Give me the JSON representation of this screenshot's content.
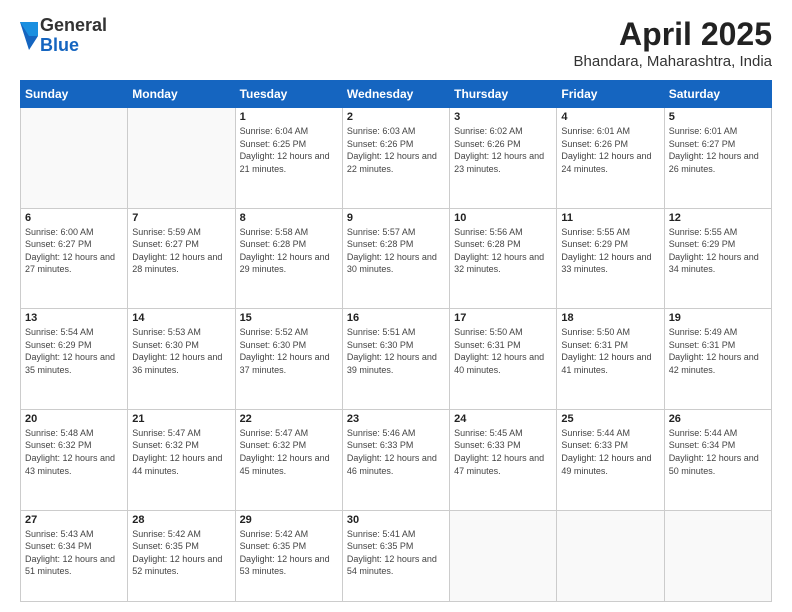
{
  "header": {
    "logo_general": "General",
    "logo_blue": "Blue",
    "title": "April 2025",
    "subtitle": "Bhandara, Maharashtra, India"
  },
  "weekdays": [
    "Sunday",
    "Monday",
    "Tuesday",
    "Wednesday",
    "Thursday",
    "Friday",
    "Saturday"
  ],
  "weeks": [
    [
      {
        "day": "",
        "sunrise": "",
        "sunset": "",
        "daylight": ""
      },
      {
        "day": "",
        "sunrise": "",
        "sunset": "",
        "daylight": ""
      },
      {
        "day": "1",
        "sunrise": "Sunrise: 6:04 AM",
        "sunset": "Sunset: 6:25 PM",
        "daylight": "Daylight: 12 hours and 21 minutes."
      },
      {
        "day": "2",
        "sunrise": "Sunrise: 6:03 AM",
        "sunset": "Sunset: 6:26 PM",
        "daylight": "Daylight: 12 hours and 22 minutes."
      },
      {
        "day": "3",
        "sunrise": "Sunrise: 6:02 AM",
        "sunset": "Sunset: 6:26 PM",
        "daylight": "Daylight: 12 hours and 23 minutes."
      },
      {
        "day": "4",
        "sunrise": "Sunrise: 6:01 AM",
        "sunset": "Sunset: 6:26 PM",
        "daylight": "Daylight: 12 hours and 24 minutes."
      },
      {
        "day": "5",
        "sunrise": "Sunrise: 6:01 AM",
        "sunset": "Sunset: 6:27 PM",
        "daylight": "Daylight: 12 hours and 26 minutes."
      }
    ],
    [
      {
        "day": "6",
        "sunrise": "Sunrise: 6:00 AM",
        "sunset": "Sunset: 6:27 PM",
        "daylight": "Daylight: 12 hours and 27 minutes."
      },
      {
        "day": "7",
        "sunrise": "Sunrise: 5:59 AM",
        "sunset": "Sunset: 6:27 PM",
        "daylight": "Daylight: 12 hours and 28 minutes."
      },
      {
        "day": "8",
        "sunrise": "Sunrise: 5:58 AM",
        "sunset": "Sunset: 6:28 PM",
        "daylight": "Daylight: 12 hours and 29 minutes."
      },
      {
        "day": "9",
        "sunrise": "Sunrise: 5:57 AM",
        "sunset": "Sunset: 6:28 PM",
        "daylight": "Daylight: 12 hours and 30 minutes."
      },
      {
        "day": "10",
        "sunrise": "Sunrise: 5:56 AM",
        "sunset": "Sunset: 6:28 PM",
        "daylight": "Daylight: 12 hours and 32 minutes."
      },
      {
        "day": "11",
        "sunrise": "Sunrise: 5:55 AM",
        "sunset": "Sunset: 6:29 PM",
        "daylight": "Daylight: 12 hours and 33 minutes."
      },
      {
        "day": "12",
        "sunrise": "Sunrise: 5:55 AM",
        "sunset": "Sunset: 6:29 PM",
        "daylight": "Daylight: 12 hours and 34 minutes."
      }
    ],
    [
      {
        "day": "13",
        "sunrise": "Sunrise: 5:54 AM",
        "sunset": "Sunset: 6:29 PM",
        "daylight": "Daylight: 12 hours and 35 minutes."
      },
      {
        "day": "14",
        "sunrise": "Sunrise: 5:53 AM",
        "sunset": "Sunset: 6:30 PM",
        "daylight": "Daylight: 12 hours and 36 minutes."
      },
      {
        "day": "15",
        "sunrise": "Sunrise: 5:52 AM",
        "sunset": "Sunset: 6:30 PM",
        "daylight": "Daylight: 12 hours and 37 minutes."
      },
      {
        "day": "16",
        "sunrise": "Sunrise: 5:51 AM",
        "sunset": "Sunset: 6:30 PM",
        "daylight": "Daylight: 12 hours and 39 minutes."
      },
      {
        "day": "17",
        "sunrise": "Sunrise: 5:50 AM",
        "sunset": "Sunset: 6:31 PM",
        "daylight": "Daylight: 12 hours and 40 minutes."
      },
      {
        "day": "18",
        "sunrise": "Sunrise: 5:50 AM",
        "sunset": "Sunset: 6:31 PM",
        "daylight": "Daylight: 12 hours and 41 minutes."
      },
      {
        "day": "19",
        "sunrise": "Sunrise: 5:49 AM",
        "sunset": "Sunset: 6:31 PM",
        "daylight": "Daylight: 12 hours and 42 minutes."
      }
    ],
    [
      {
        "day": "20",
        "sunrise": "Sunrise: 5:48 AM",
        "sunset": "Sunset: 6:32 PM",
        "daylight": "Daylight: 12 hours and 43 minutes."
      },
      {
        "day": "21",
        "sunrise": "Sunrise: 5:47 AM",
        "sunset": "Sunset: 6:32 PM",
        "daylight": "Daylight: 12 hours and 44 minutes."
      },
      {
        "day": "22",
        "sunrise": "Sunrise: 5:47 AM",
        "sunset": "Sunset: 6:32 PM",
        "daylight": "Daylight: 12 hours and 45 minutes."
      },
      {
        "day": "23",
        "sunrise": "Sunrise: 5:46 AM",
        "sunset": "Sunset: 6:33 PM",
        "daylight": "Daylight: 12 hours and 46 minutes."
      },
      {
        "day": "24",
        "sunrise": "Sunrise: 5:45 AM",
        "sunset": "Sunset: 6:33 PM",
        "daylight": "Daylight: 12 hours and 47 minutes."
      },
      {
        "day": "25",
        "sunrise": "Sunrise: 5:44 AM",
        "sunset": "Sunset: 6:33 PM",
        "daylight": "Daylight: 12 hours and 49 minutes."
      },
      {
        "day": "26",
        "sunrise": "Sunrise: 5:44 AM",
        "sunset": "Sunset: 6:34 PM",
        "daylight": "Daylight: 12 hours and 50 minutes."
      }
    ],
    [
      {
        "day": "27",
        "sunrise": "Sunrise: 5:43 AM",
        "sunset": "Sunset: 6:34 PM",
        "daylight": "Daylight: 12 hours and 51 minutes."
      },
      {
        "day": "28",
        "sunrise": "Sunrise: 5:42 AM",
        "sunset": "Sunset: 6:35 PM",
        "daylight": "Daylight: 12 hours and 52 minutes."
      },
      {
        "day": "29",
        "sunrise": "Sunrise: 5:42 AM",
        "sunset": "Sunset: 6:35 PM",
        "daylight": "Daylight: 12 hours and 53 minutes."
      },
      {
        "day": "30",
        "sunrise": "Sunrise: 5:41 AM",
        "sunset": "Sunset: 6:35 PM",
        "daylight": "Daylight: 12 hours and 54 minutes."
      },
      {
        "day": "",
        "sunrise": "",
        "sunset": "",
        "daylight": ""
      },
      {
        "day": "",
        "sunrise": "",
        "sunset": "",
        "daylight": ""
      },
      {
        "day": "",
        "sunrise": "",
        "sunset": "",
        "daylight": ""
      }
    ]
  ]
}
